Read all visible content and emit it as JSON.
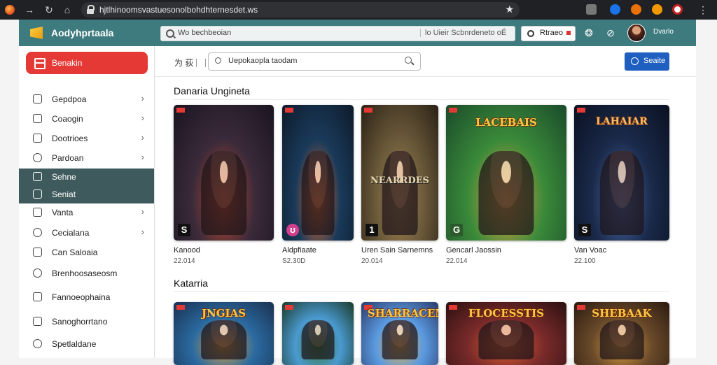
{
  "browser": {
    "url": "hjtlhinoomsvastuesonolbohdhternesdet.ws",
    "icons": [
      "back-icon",
      "forward-icon",
      "reload-icon",
      "home-icon",
      "star-icon",
      "menu-icon"
    ]
  },
  "header": {
    "brand": "Aodyhprtaala",
    "search_placeholder": "Wo bechbeoian",
    "search_hint": "lo Uieir Scbnrdeneto oÉ",
    "search_button": "Rtraeo",
    "username": "Dvarlo"
  },
  "sidebar": {
    "cta_label": "Benakin",
    "items": [
      {
        "label": "Gepdpoa",
        "icon": "hand-icon",
        "chevron": "›",
        "active": false
      },
      {
        "label": "Coaogin",
        "icon": "shield-icon",
        "chevron": "›",
        "active": false
      },
      {
        "label": "Dootrioes",
        "icon": "box-icon",
        "chevron": "›",
        "active": false
      },
      {
        "label": "Pardoan",
        "icon": "clock-icon",
        "chevron": "›",
        "active": false
      },
      {
        "label": "Sehne",
        "icon": "grid-icon",
        "chevron": "",
        "active": true
      },
      {
        "label": "Seniat",
        "icon": "shield-icon",
        "chevron": "",
        "active": true
      },
      {
        "label": "Vanta",
        "icon": "box-icon",
        "chevron": "›",
        "active": false
      },
      {
        "label": "Cecialana",
        "icon": "bubble-icon",
        "chevron": "›",
        "active": false
      },
      {
        "label": "Can Saloaia",
        "icon": "hand-icon",
        "chevron": "",
        "active": false
      },
      {
        "label": "Brenhoosaseosm",
        "icon": "circle-icon",
        "chevron": "",
        "active": false
      },
      {
        "label": "Fannoeophaina",
        "icon": "doc-icon",
        "chevron": "",
        "active": false
      },
      {
        "label": "Sanoghorrtano",
        "icon": "list-icon",
        "chevron": "",
        "active": false
      },
      {
        "label": "Spetlaldane",
        "icon": "chat-icon",
        "chevron": "",
        "active": false
      }
    ]
  },
  "main": {
    "lang": "为 荻",
    "search_placeholder": "Uepokaopla taodam",
    "action_button": "Seaite",
    "sections": [
      {
        "title": "Danaria Ungineta",
        "games": [
          {
            "name": "Kanood",
            "year": "22.014",
            "mark": "S",
            "art": "",
            "colors": [
              "#3a2a3a",
              "#c24a2a",
              "#1a1420"
            ]
          },
          {
            "name": "Aldpfiaate",
            "year": "S2.30D",
            "mark": "ʊ",
            "art": "",
            "colors": [
              "#1a3a5a",
              "#e46a2a",
              "#0d1a2a"
            ]
          },
          {
            "name": "Uren Sain Sarnemns",
            "year": "20.014",
            "mark": "1",
            "art": "NEARRDES",
            "colors": [
              "#6b5a3a",
              "#a08050",
              "#2a2015"
            ]
          },
          {
            "name": "Gencarl Jaossin",
            "year": "22.014",
            "mark": "G",
            "art": "LACEBAIS",
            "colors": [
              "#3a8a3a",
              "#e0a040",
              "#1a4a2a"
            ]
          },
          {
            "name": "Van Voac",
            "year": "22.100",
            "mark": "S",
            "art": "LAHAIAR",
            "colors": [
              "#1a2a4a",
              "#4a6aaa",
              "#0a1020"
            ]
          }
        ]
      },
      {
        "title": "Katarria",
        "games": [
          {
            "name": "",
            "year": "",
            "mark": "",
            "art": "JNGIAS",
            "colors": [
              "#2a6aa0",
              "#e0a040",
              "#1a3050"
            ]
          },
          {
            "name": "",
            "year": "",
            "mark": "",
            "art": "",
            "colors": [
              "#4a9ad0",
              "#3a7a3a",
              "#1a3a2a"
            ]
          },
          {
            "name": "",
            "year": "",
            "mark": "",
            "art": "SHARRACEMAN",
            "colors": [
              "#5a9ae0",
              "#e0b050",
              "#2a3a6a"
            ]
          },
          {
            "name": "",
            "year": "",
            "mark": "",
            "art": "FLOCESSTIS",
            "colors": [
              "#7a2a2a",
              "#e06030",
              "#2a1010"
            ]
          },
          {
            "name": "",
            "year": "",
            "mark": "",
            "art": "SHEBAAK",
            "colors": [
              "#6a4a2a",
              "#e0a040",
              "#2a1a10"
            ]
          }
        ]
      }
    ]
  },
  "colors": {
    "appbar": "#3d7b7f",
    "cta": "#e53935",
    "active_nav": "#3f5a5c",
    "primary_button": "#1e5fbf"
  }
}
